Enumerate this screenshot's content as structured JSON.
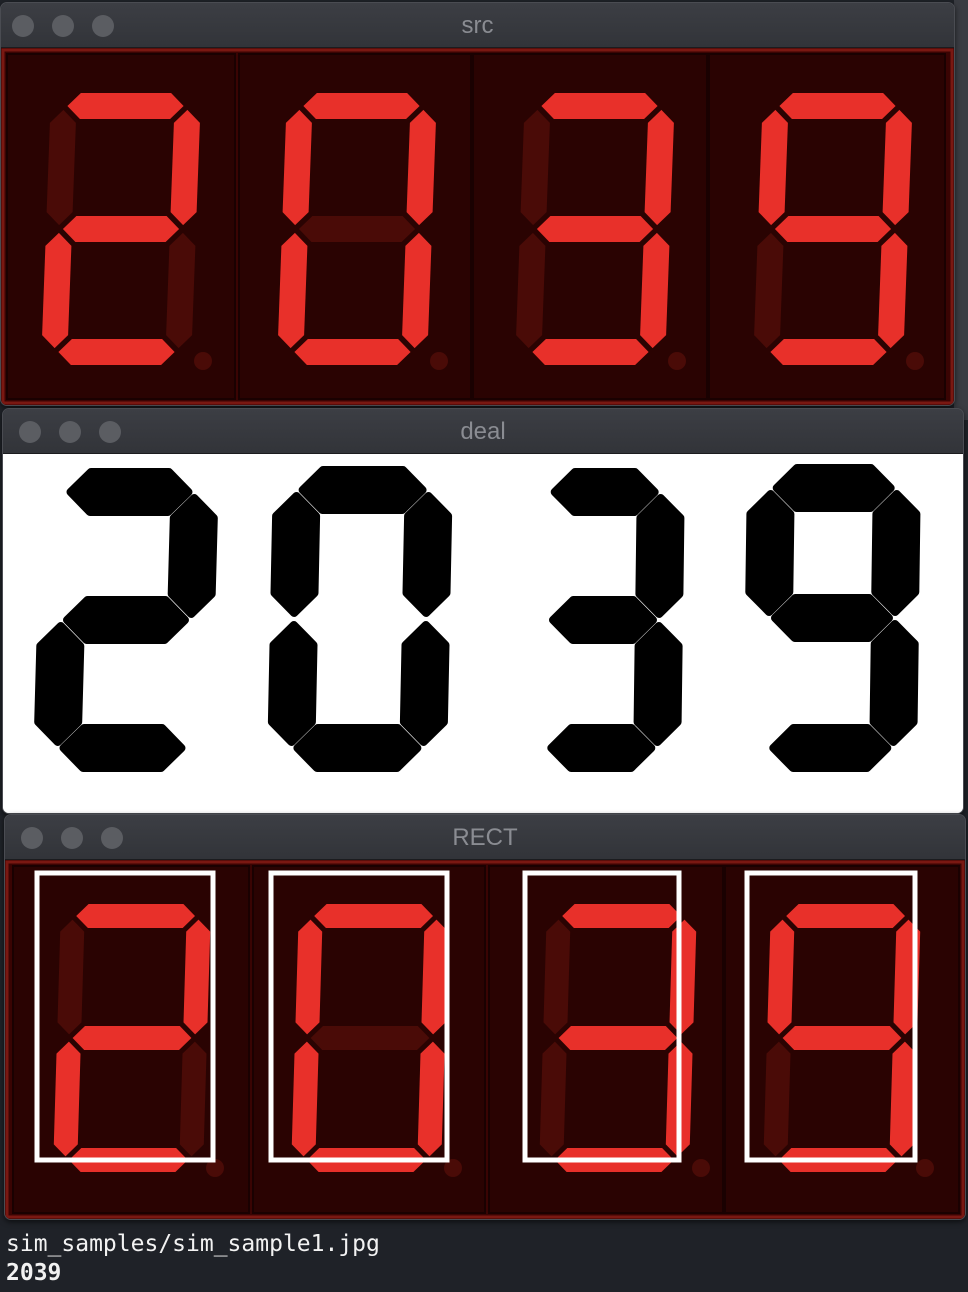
{
  "windows": {
    "src": {
      "title": "src"
    },
    "deal": {
      "title": "deal"
    },
    "rect": {
      "title": "RECT"
    }
  },
  "display": {
    "digits": [
      "2",
      "0",
      "3",
      "9"
    ]
  },
  "terminal": {
    "lines": [
      "sim_samples/sim_sample1.jpg",
      "2039"
    ]
  },
  "colors": {
    "led_on": "#e8302a",
    "led_off": "#4a0b07",
    "led_bg": "#3a0403",
    "led_frame": "#7a1812",
    "deal_fg": "#000000",
    "deal_bg": "#ffffff",
    "rect_box": "#ffffff",
    "terminal_bg": "#1f2228"
  }
}
